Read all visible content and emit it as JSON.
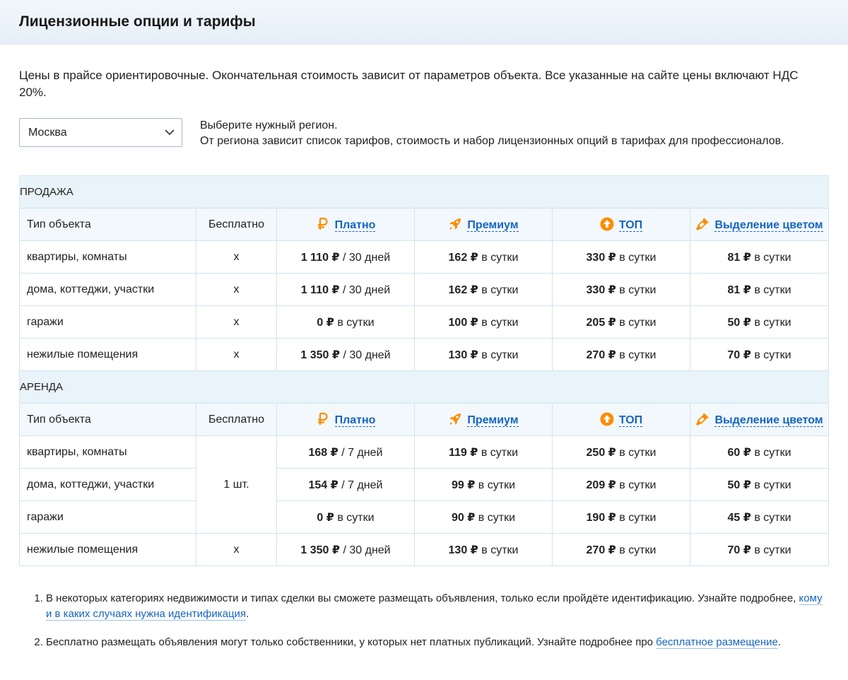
{
  "page": {
    "title": "Лицензионные опции и тарифы"
  },
  "intro": "Цены в прайсе ориентировочные. Окончательная стоимость зависит от параметров объекта. Все указанные на сайте цены включают НДС 20%.",
  "region": {
    "selected": "Москва",
    "hint_line1": "Выберите нужный регион.",
    "hint_line2": "От региона зависит список тарифов, стоимость и набор лицензионных опций в тарифах для профессионалов."
  },
  "columns": {
    "type": "Тип объекта",
    "free": "Бесплатно",
    "paid": "Платно",
    "premium": "Премиум",
    "top": "ТОП",
    "color": "Выделение цветом"
  },
  "icons": {
    "paid": "ruble-icon",
    "premium": "rocket-icon",
    "top": "arrow-up-circle-icon",
    "color": "paint-brush-icon"
  },
  "colors": {
    "accent": "#ff8c00",
    "link": "#1565c0",
    "header_bg": "#e9f3fa"
  },
  "sale": {
    "title": "ПРОДАЖА",
    "rows": [
      {
        "type": "квартиры, комнаты",
        "free": "x",
        "paid_amount": "1 110 ₽",
        "paid_unit": "/ 30 дней",
        "premium_amount": "162 ₽",
        "premium_unit": "в сутки",
        "top_amount": "330 ₽",
        "top_unit": "в сутки",
        "color_amount": "81 ₽",
        "color_unit": "в сутки"
      },
      {
        "type": "дома, коттеджи, участки",
        "free": "x",
        "paid_amount": "1 110 ₽",
        "paid_unit": "/ 30 дней",
        "premium_amount": "162 ₽",
        "premium_unit": "в сутки",
        "top_amount": "330 ₽",
        "top_unit": "в сутки",
        "color_amount": "81 ₽",
        "color_unit": "в сутки"
      },
      {
        "type": "гаражи",
        "free": "x",
        "paid_amount": "0 ₽",
        "paid_unit": "в сутки",
        "premium_amount": "100 ₽",
        "premium_unit": "в сутки",
        "top_amount": "205 ₽",
        "top_unit": "в сутки",
        "color_amount": "50 ₽",
        "color_unit": "в сутки"
      },
      {
        "type": "нежилые помещения",
        "free": "x",
        "paid_amount": "1 350 ₽",
        "paid_unit": "/ 30 дней",
        "premium_amount": "130 ₽",
        "premium_unit": "в сутки",
        "top_amount": "270 ₽",
        "top_unit": "в сутки",
        "color_amount": "70 ₽",
        "color_unit": "в сутки"
      }
    ]
  },
  "rent": {
    "title": "АРЕНДА",
    "free_merged": "1 шт.",
    "rows": [
      {
        "type": "квартиры, комнаты",
        "free": "",
        "paid_amount": "168 ₽",
        "paid_unit": "/ 7 дней",
        "premium_amount": "119 ₽",
        "premium_unit": "в сутки",
        "top_amount": "250 ₽",
        "top_unit": "в сутки",
        "color_amount": "60 ₽",
        "color_unit": "в сутки"
      },
      {
        "type": "дома, коттеджи, участки",
        "free": "",
        "paid_amount": "154 ₽",
        "paid_unit": "/ 7 дней",
        "premium_amount": "99 ₽",
        "premium_unit": "в сутки",
        "top_amount": "209 ₽",
        "top_unit": "в сутки",
        "color_amount": "50 ₽",
        "color_unit": "в сутки"
      },
      {
        "type": "гаражи",
        "free": "",
        "paid_amount": "0 ₽",
        "paid_unit": "в сутки",
        "premium_amount": "90 ₽",
        "premium_unit": "в сутки",
        "top_amount": "190 ₽",
        "top_unit": "в сутки",
        "color_amount": "45 ₽",
        "color_unit": "в сутки"
      },
      {
        "type": "нежилые помещения",
        "free": "x",
        "paid_amount": "1 350 ₽",
        "paid_unit": "/ 30 дней",
        "premium_amount": "130 ₽",
        "premium_unit": "в сутки",
        "top_amount": "270 ₽",
        "top_unit": "в сутки",
        "color_amount": "70 ₽",
        "color_unit": "в сутки"
      }
    ]
  },
  "notes": [
    {
      "text": "В некоторых категориях недвижимости и типах сделки вы сможете размещать объявления, только если пройдёте идентификацию. Узнайте подробнее,",
      "link": "кому и в каких случаях нужна идентификация",
      "suffix": "."
    },
    {
      "text": "Бесплатно размещать объявления могут только собственники, у которых нет платных публикаций. Узнайте подробнее про",
      "link": "бесплатное размещение",
      "suffix": "."
    }
  ]
}
